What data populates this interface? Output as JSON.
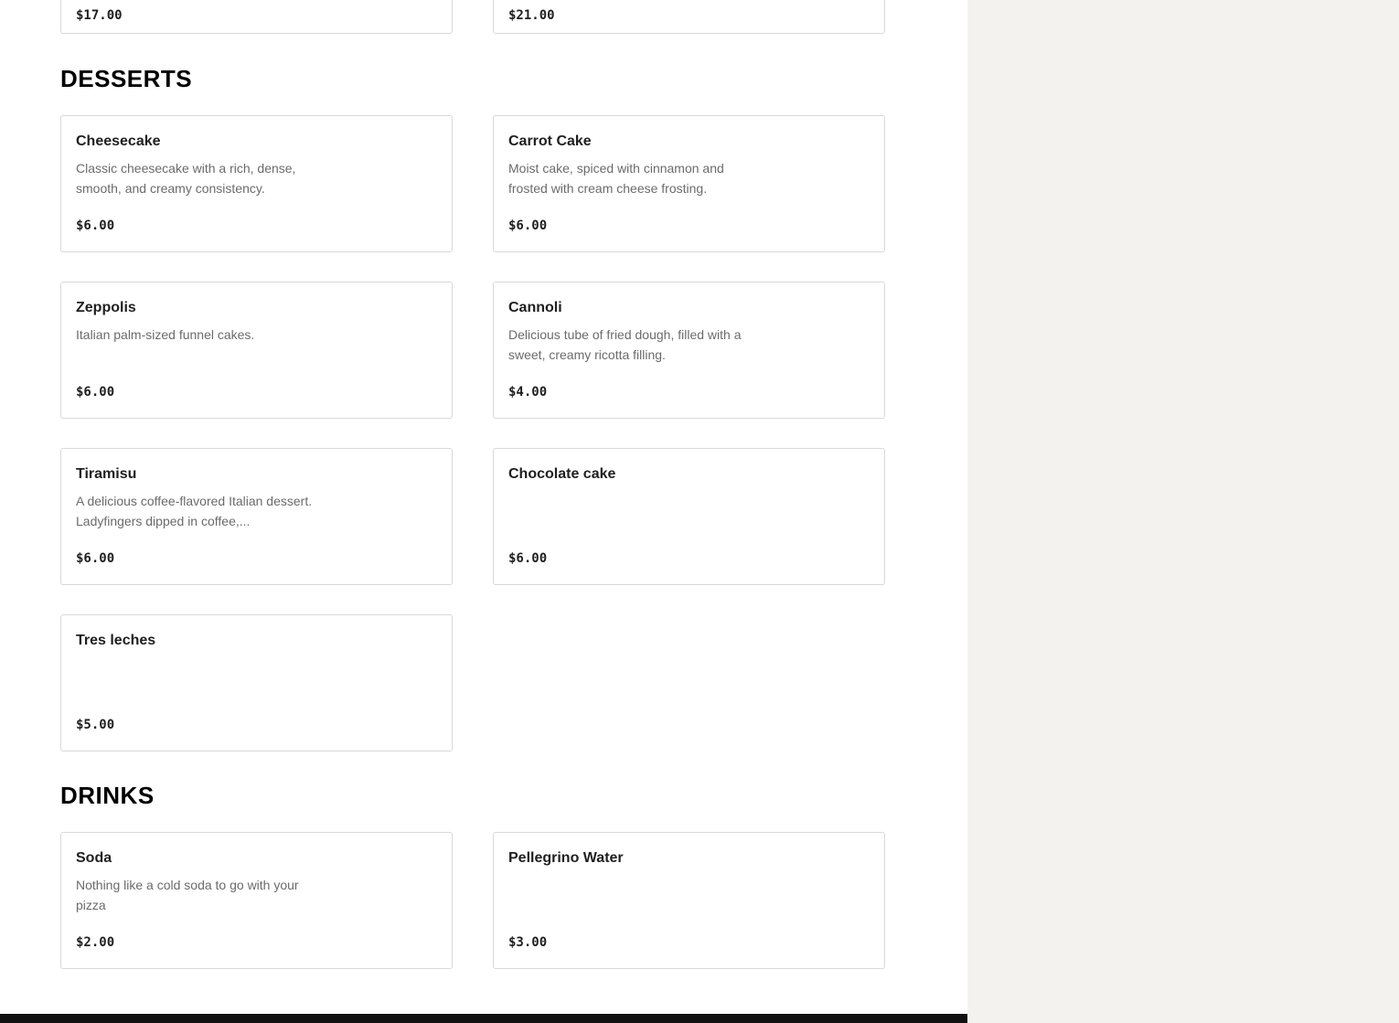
{
  "previous_section": {
    "items": [
      {
        "price": "$17.00"
      },
      {
        "price": "$21.00"
      }
    ]
  },
  "desserts": {
    "title": "DESSERTS",
    "items": [
      {
        "name": "Cheesecake",
        "description": "Classic cheesecake with a rich, dense, smooth, and creamy consistency.",
        "price": "$6.00"
      },
      {
        "name": "Carrot Cake",
        "description": "Moist cake, spiced with cinnamon and frosted with cream cheese frosting.",
        "price": "$6.00"
      },
      {
        "name": "Zeppolis",
        "description": "Italian palm-sized funnel cakes.",
        "price": "$6.00"
      },
      {
        "name": "Cannoli",
        "description": "Delicious tube of fried dough, filled with a sweet, creamy ricotta filling.",
        "price": "$4.00"
      },
      {
        "name": "Tiramisu",
        "description": "A delicious coffee-flavored Italian dessert. Ladyfingers dipped in coffee,...",
        "price": "$6.00"
      },
      {
        "name": "Chocolate cake",
        "description": "",
        "price": "$6.00"
      },
      {
        "name": "Tres leches",
        "description": "",
        "price": "$5.00"
      }
    ]
  },
  "drinks": {
    "title": "DRINKS",
    "items": [
      {
        "name": "Soda",
        "description": "Nothing like a cold soda to go with your pizza",
        "price": "$2.00"
      },
      {
        "name": "Pellegrino Water",
        "description": "",
        "price": "$3.00"
      }
    ]
  },
  "colors": {
    "side_panel": "#f3f2ef",
    "card_border": "#d9d9d9",
    "footer": "#111111"
  }
}
